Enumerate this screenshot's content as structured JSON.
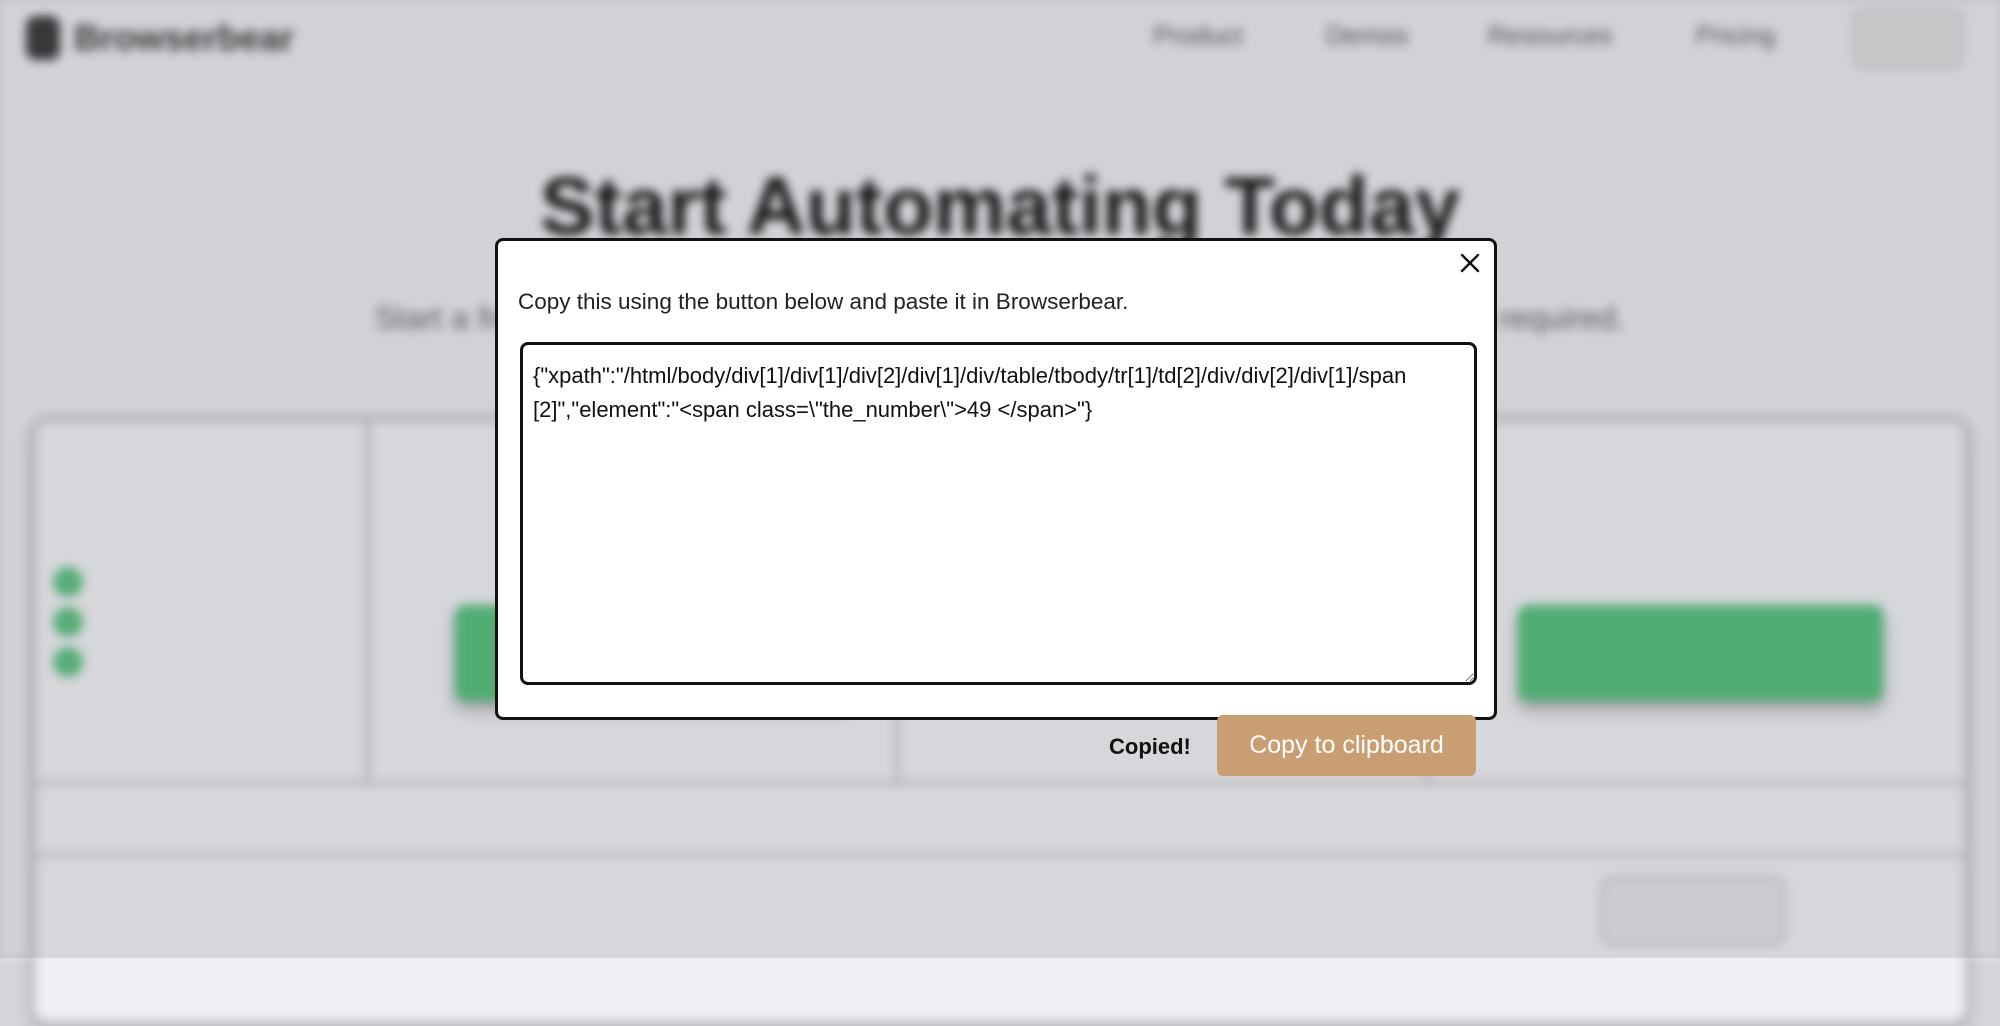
{
  "background": {
    "logo_text": "Browserbear",
    "nav_links": [
      "Product",
      "Demos",
      "Resources",
      "Pricing"
    ],
    "hero_title": "Start Automating Today",
    "hero_subtitle": "Start a free trial and upgrade as your automation needs expand. No credit card required."
  },
  "modal": {
    "close_icon": "close-icon",
    "instructions": "Copy this using the button below and paste it in Browserbear.",
    "code_value": "{\"xpath\":\"/html/body/div[1]/div[1]/div[2]/div[1]/div/table/tbody/tr[1]/td[2]/div/div[2]/div[1]/span[2]\",\"element\":\"<span class=\\\"the_number\\\">49 </span>\"}",
    "copied_label": "Copied!",
    "copy_button_label": "Copy to clipboard",
    "copy_button_color": "#c99e73"
  }
}
